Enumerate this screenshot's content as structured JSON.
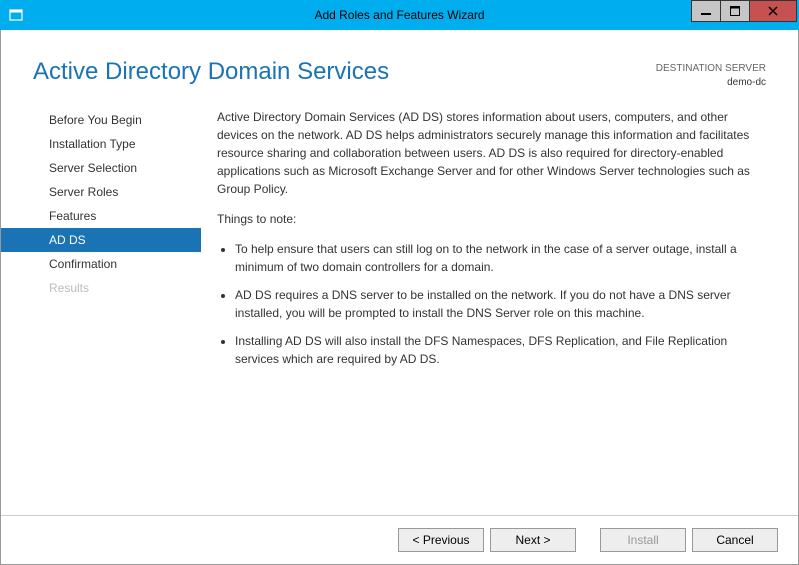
{
  "titlebar": {
    "title": "Add Roles and Features Wizard"
  },
  "header": {
    "page_title": "Active Directory Domain Services",
    "dest_label": "DESTINATION SERVER",
    "dest_name": "demo-dc"
  },
  "sidebar": {
    "items": [
      {
        "label": "Before You Begin",
        "selected": false,
        "disabled": false
      },
      {
        "label": "Installation Type",
        "selected": false,
        "disabled": false
      },
      {
        "label": "Server Selection",
        "selected": false,
        "disabled": false
      },
      {
        "label": "Server Roles",
        "selected": false,
        "disabled": false
      },
      {
        "label": "Features",
        "selected": false,
        "disabled": false
      },
      {
        "label": "AD DS",
        "selected": true,
        "disabled": false
      },
      {
        "label": "Confirmation",
        "selected": false,
        "disabled": false
      },
      {
        "label": "Results",
        "selected": false,
        "disabled": true
      }
    ]
  },
  "main": {
    "intro": "Active Directory Domain Services (AD DS) stores information about users, computers, and other devices on the network.  AD DS helps administrators securely manage this information and facilitates resource sharing and collaboration between users.  AD DS is also required for directory-enabled applications such as Microsoft Exchange Server and for other Windows Server technologies such as Group Policy.",
    "notes_heading": "Things to note:",
    "notes": [
      "To help ensure that users can still log on to the network in the case of a server outage, install a minimum of two domain controllers for a domain.",
      "AD DS requires a DNS server to be installed on the network.  If you do not have a DNS server installed, you will be prompted to install the DNS Server role on this machine.",
      "Installing AD DS will also install the DFS Namespaces, DFS Replication, and File Replication services which are required by AD DS."
    ]
  },
  "footer": {
    "previous": "< Previous",
    "next": "Next >",
    "install": "Install",
    "cancel": "Cancel"
  }
}
